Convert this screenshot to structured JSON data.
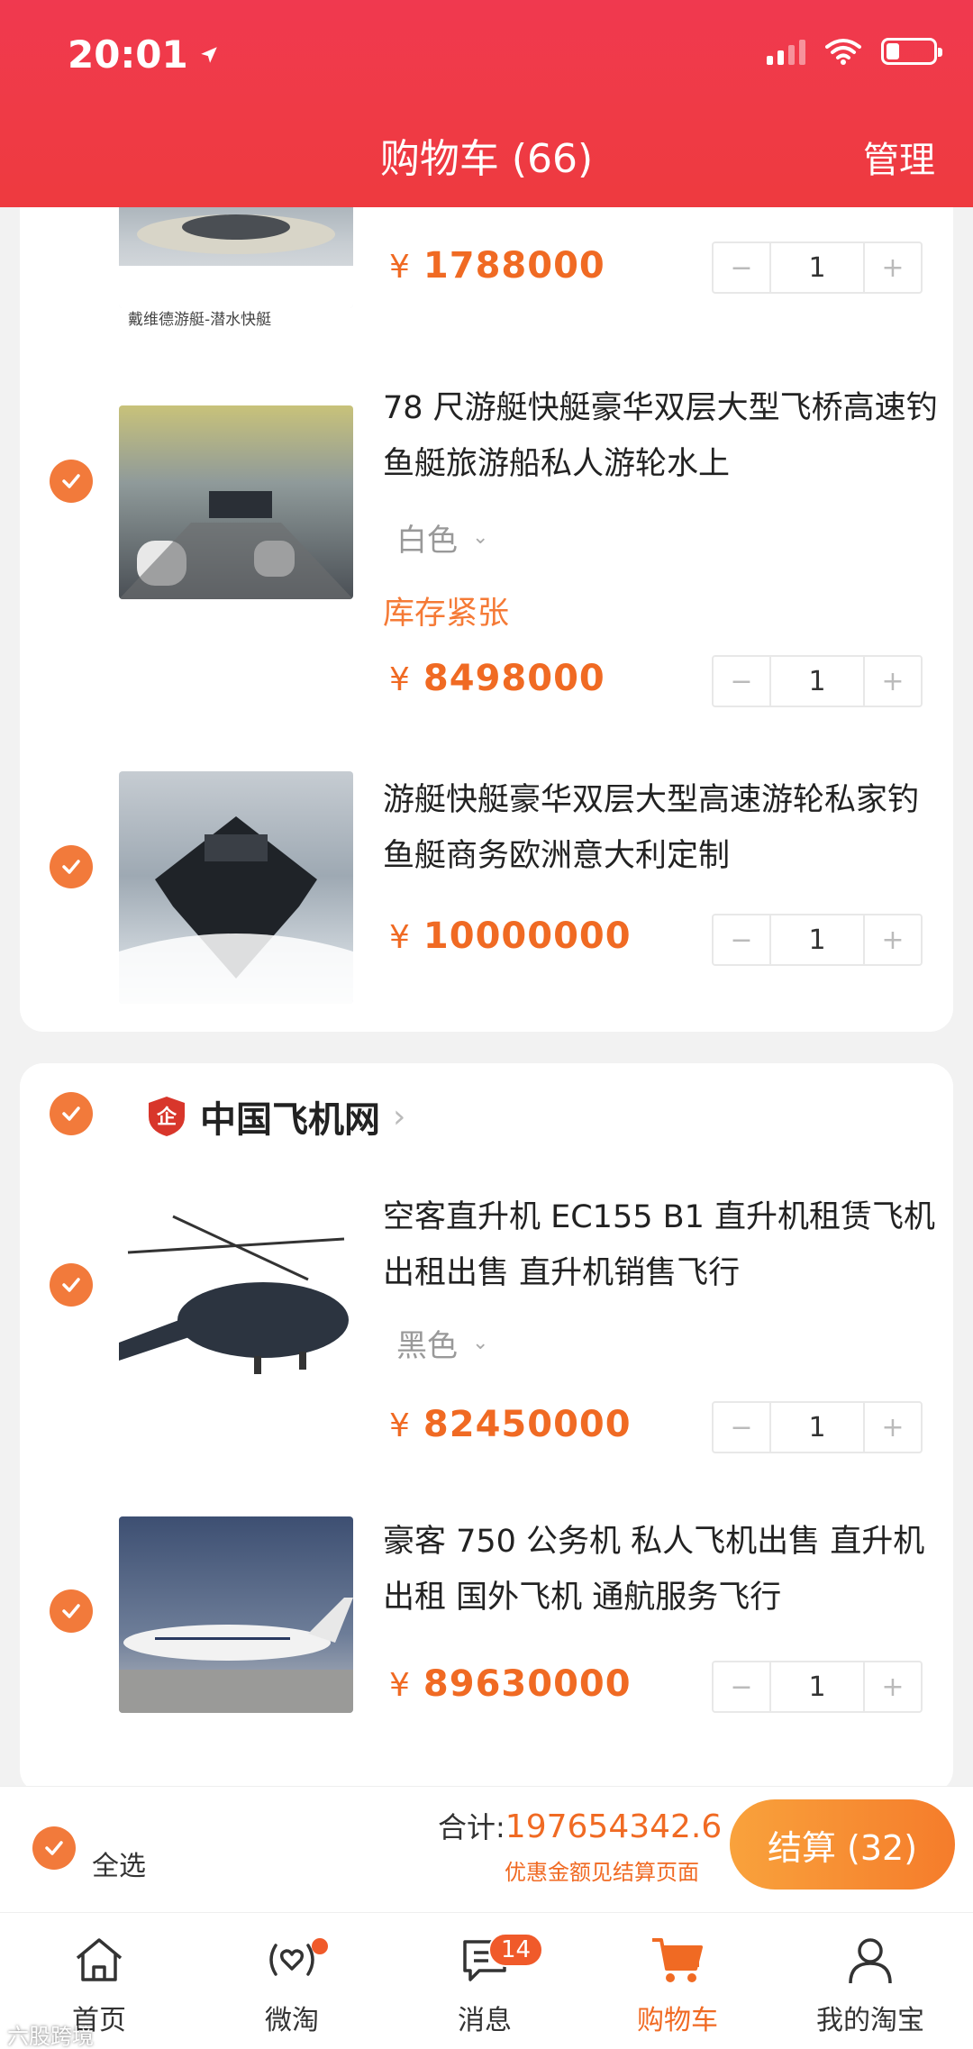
{
  "status": {
    "time": "20:01"
  },
  "header": {
    "title": "购物车 (66)",
    "manage": "管理"
  },
  "items": [
    {
      "image_caption": "戴维德游艇-潜水快艇",
      "price": "1788000",
      "qty": "1"
    },
    {
      "title": "78 尺游艇快艇豪华双层大型飞桥高速钓鱼艇旅游船私人游轮水上",
      "variant": "白色",
      "stock": "库存紧张",
      "price": "8498000",
      "qty": "1"
    },
    {
      "title": "游艇快艇豪华双层大型高速游轮私家钓鱼艇商务欧洲意大利定制",
      "price": "10000000",
      "qty": "1"
    }
  ],
  "shop2": {
    "name": "中国飞机网",
    "items": [
      {
        "title": "空客直升机 EC155 B1 直升机租赁飞机出租出售 直升机销售飞行",
        "variant": "黑色",
        "price": "82450000",
        "qty": "1"
      },
      {
        "title": "豪客 750 公务机 私人飞机出售 直升机出租 国外飞机 通航服务飞行",
        "price": "89630000",
        "qty": "1"
      }
    ]
  },
  "currency": "¥",
  "checkout": {
    "select_all": "全选",
    "total_label": "合计:",
    "total_amount": "197654342.6",
    "discount_note": "优惠金额见结算页面",
    "button": "结算 (32)"
  },
  "tabbar": {
    "home": "首页",
    "weitao": "微淘",
    "messages": "消息",
    "messages_badge": "14",
    "cart": "购物车",
    "mine": "我的淘宝"
  },
  "watermark": "六股跨境",
  "colors": {
    "header": "#ef3a45",
    "accent": "#f06a23",
    "check": "#f27a3b"
  }
}
